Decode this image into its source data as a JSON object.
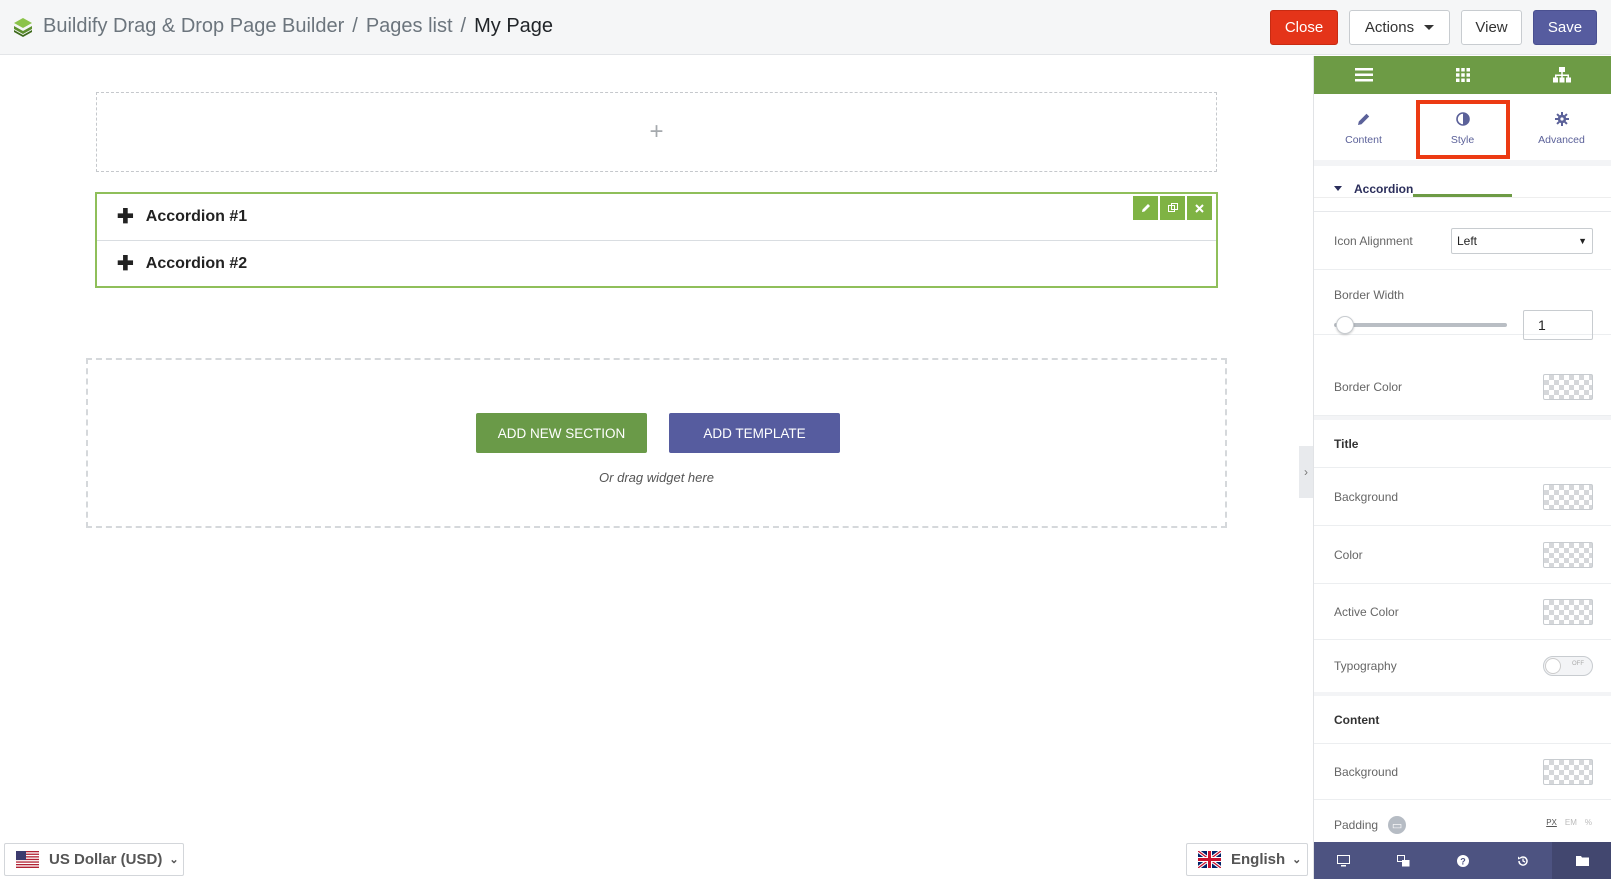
{
  "breadcrumb": {
    "app_name": "Buildify Drag & Drop Page Builder",
    "separator": "/",
    "pages_list": "Pages list",
    "current_page": "My Page"
  },
  "toolbar": {
    "close_label": "Close",
    "actions_label": "Actions",
    "view_label": "View",
    "save_label": "Save"
  },
  "canvas": {
    "add_symbol": "+",
    "accordion_items": [
      "Accordion #1",
      "Accordion #2"
    ],
    "add_section_label": "ADD NEW SECTION",
    "add_template_label": "ADD TEMPLATE",
    "drag_hint": "Or drag widget here"
  },
  "panel": {
    "tabs": [
      {
        "label": "Content",
        "icon": "pencil-icon"
      },
      {
        "label": "Style",
        "icon": "contrast-icon"
      },
      {
        "label": "Advanced",
        "icon": "gear-icon"
      }
    ],
    "active_tab": "Style",
    "sections": {
      "accordion": {
        "title": "Accordion",
        "icon_alignment_label": "Icon Alignment",
        "icon_alignment_value": "Left",
        "border_width_label": "Border Width",
        "border_width_value": "1",
        "border_color_label": "Border Color"
      },
      "title": {
        "title": "Title",
        "background_label": "Background",
        "color_label": "Color",
        "active_color_label": "Active Color",
        "typography_label": "Typography",
        "toggle_text": "OFF"
      },
      "content": {
        "title": "Content",
        "background_label": "Background",
        "padding_label": "Padding",
        "units": [
          "PX",
          "EM",
          "%"
        ]
      }
    }
  },
  "footer": {
    "currency": "US Dollar (USD)",
    "language": "English"
  },
  "colors": {
    "brand_green": "#6d9b45",
    "brand_purple": "#565c9f",
    "close_red": "#e43419",
    "highlight_red": "#ec3a13"
  }
}
